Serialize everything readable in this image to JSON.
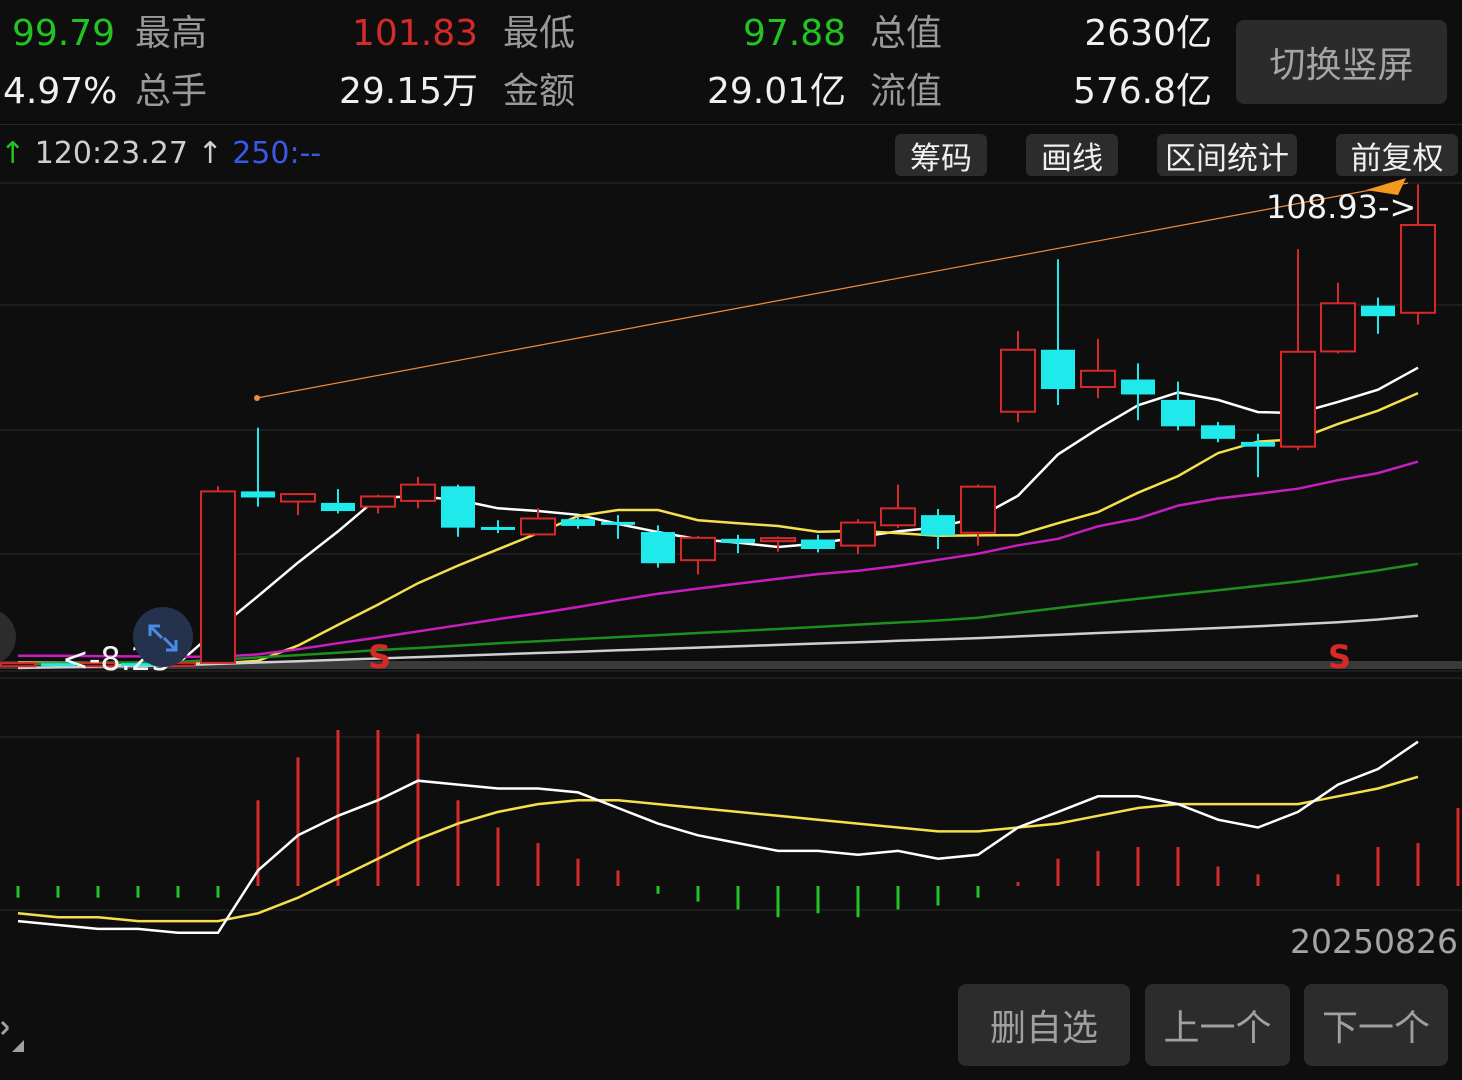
{
  "stats": {
    "price": "99.79",
    "high_label": "最高",
    "high": "101.83",
    "low_label": "最低",
    "low": "97.88",
    "total_mv_label": "总值",
    "total_mv": "2630亿",
    "change_pct": "4.97%",
    "volume_label": "总手",
    "volume": "29.15万",
    "amount_label": "金额",
    "amount": "29.01亿",
    "float_mv_label": "流值",
    "float_mv": "576.8亿"
  },
  "buttons": {
    "switch_portrait": "切换竖屏",
    "chip": "筹码",
    "draw_line": "画线",
    "range_stats": "区间统计",
    "forward_adjust": "前复权",
    "remove_watchlist": "删自选",
    "previous": "上一个",
    "next": "下一个"
  },
  "ma_legend": {
    "ma120": "120:23.27",
    "ma250": "250:--",
    "arrow": "↑"
  },
  "annotations": {
    "high_marker": "108.93->",
    "low_marker": "<-8.25",
    "signal_s": "S"
  },
  "date": "20250826",
  "colors": {
    "up": "#d62a2a",
    "down": "#1fe9ea",
    "ma5": "#ffffff",
    "ma10": "#f4e04d",
    "ma20": "#c81ec0",
    "ma60": "#1c8f1c",
    "ma120": "#cfcfcf",
    "trendline": "#f08b3a"
  },
  "chart_data": {
    "type": "candlestick",
    "candles": [
      {
        "o": 8.1,
        "c": 8.3,
        "h": 8.6,
        "l": 7.9
      },
      {
        "o": 8.3,
        "c": 8.0,
        "h": 8.4,
        "l": 7.9
      },
      {
        "o": 8.0,
        "c": 8.3,
        "h": 8.4,
        "l": 7.9
      },
      {
        "o": 8.3,
        "c": 8.1,
        "h": 8.4,
        "l": 8.0
      },
      {
        "o": 8.1,
        "c": 8.4,
        "h": 8.5,
        "l": 8.0
      },
      {
        "o": 8.4,
        "c": 59.0,
        "h": 60.5,
        "l": 8.4
      },
      {
        "o": 59.0,
        "c": 57.2,
        "h": 77.8,
        "l": 54.5
      },
      {
        "o": 56.0,
        "c": 58.2,
        "h": 58.5,
        "l": 52.0
      },
      {
        "o": 55.6,
        "c": 53.2,
        "h": 59.7,
        "l": 52.5
      },
      {
        "o": 54.5,
        "c": 57.5,
        "h": 58.0,
        "l": 52.5
      },
      {
        "o": 56.2,
        "c": 61.0,
        "h": 63.3,
        "l": 54.0
      },
      {
        "o": 60.5,
        "c": 48.3,
        "h": 61.0,
        "l": 45.6
      },
      {
        "o": 48.5,
        "c": 48.0,
        "h": 50.5,
        "l": 46.7
      },
      {
        "o": 46.3,
        "c": 51.0,
        "h": 54.0,
        "l": 46.3
      },
      {
        "o": 50.8,
        "c": 48.8,
        "h": 51.5,
        "l": 48.0
      },
      {
        "o": 50.0,
        "c": 49.2,
        "h": 52.0,
        "l": 45.0
      },
      {
        "o": 47.0,
        "c": 37.8,
        "h": 49.0,
        "l": 36.5
      },
      {
        "o": 38.7,
        "c": 45.3,
        "h": 45.8,
        "l": 34.5
      },
      {
        "o": 45.0,
        "c": 43.8,
        "h": 46.2,
        "l": 40.8
      },
      {
        "o": 44.5,
        "c": 45.2,
        "h": 45.7,
        "l": 41.2
      },
      {
        "o": 44.8,
        "c": 42.0,
        "h": 46.2,
        "l": 41.0
      },
      {
        "o": 43.0,
        "c": 49.8,
        "h": 50.8,
        "l": 40.5
      },
      {
        "o": 49.0,
        "c": 54.0,
        "h": 61.0,
        "l": 48.2
      },
      {
        "o": 52.0,
        "c": 46.0,
        "h": 53.8,
        "l": 42.0
      },
      {
        "o": 46.8,
        "c": 60.4,
        "h": 61.0,
        "l": 43.0
      },
      {
        "o": 82.5,
        "c": 100.8,
        "h": 106.3,
        "l": 79.4
      },
      {
        "o": 100.8,
        "c": 89.2,
        "h": 127.5,
        "l": 84.5
      },
      {
        "o": 89.8,
        "c": 94.6,
        "h": 104.0,
        "l": 86.5
      },
      {
        "o": 92.0,
        "c": 87.6,
        "h": 96.8,
        "l": 80.0
      },
      {
        "o": 86.0,
        "c": 78.2,
        "h": 91.4,
        "l": 77.0
      },
      {
        "o": 78.5,
        "c": 74.5,
        "h": 79.5,
        "l": 73.5
      },
      {
        "o": 73.6,
        "c": 72.2,
        "h": 76.0,
        "l": 63.2
      },
      {
        "o": 72.2,
        "c": 100.2,
        "h": 130.5,
        "l": 71.2
      },
      {
        "o": 100.3,
        "c": 114.5,
        "h": 120.6,
        "l": 99.7
      },
      {
        "o": 113.8,
        "c": 110.7,
        "h": 116.2,
        "l": 105.5
      },
      {
        "o": 111.7,
        "c": 137.6,
        "h": 149.6,
        "l": 108.2
      }
    ],
    "moving_averages": [
      {
        "name": "MA5",
        "color": "#ffffff",
        "values": [
          8.3,
          8.2,
          8.1,
          8.2,
          8.2,
          18.4,
          28.1,
          38.0,
          47.2,
          57.2,
          57.5,
          56.5,
          54.0,
          53.2,
          52.1,
          49.4,
          47.0,
          44.9,
          43.9,
          42.6,
          43.6,
          45.5,
          47.2,
          48.4,
          51.3,
          57.7,
          69.9,
          77.5,
          84.4,
          88.2,
          86.0,
          82.4,
          82.1,
          85.4,
          89.0,
          95.5
        ]
      },
      {
        "name": "MA10",
        "color": "#f4e04d",
        "values": [
          8.5,
          8.4,
          8.3,
          8.2,
          8.2,
          8.2,
          9.0,
          13.5,
          19.6,
          25.6,
          31.9,
          37.1,
          41.9,
          46.7,
          51.7,
          53.5,
          53.5,
          50.5,
          49.6,
          48.8,
          47.1,
          47.3,
          46.7,
          45.9,
          46.0,
          46.1,
          49.6,
          52.9,
          58.6,
          63.5,
          70.3,
          73.7,
          74.4,
          78.9,
          82.8,
          88.0
        ]
      },
      {
        "name": "MA20",
        "color": "#c81ec0",
        "values": [
          10.5,
          10.5,
          10.4,
          10.3,
          10.2,
          10.2,
          10.9,
          12.4,
          14.2,
          15.9,
          17.7,
          19.5,
          21.3,
          23.0,
          24.9,
          26.9,
          28.8,
          30.3,
          31.8,
          33.2,
          34.6,
          35.6,
          37.0,
          38.8,
          40.6,
          43.1,
          45.0,
          48.7,
          51.0,
          54.8,
          56.9,
          58.3,
          59.8,
          62.3,
          64.4,
          67.8
        ]
      },
      {
        "name": "MA60",
        "color": "#1c8f1c",
        "values": [
          8.2,
          8.2,
          8.3,
          8.5,
          8.7,
          9.3,
          10.0,
          10.7,
          11.4,
          12.2,
          12.8,
          13.5,
          14.2,
          14.8,
          15.4,
          16.0,
          16.6,
          17.2,
          17.8,
          18.4,
          19.0,
          19.7,
          20.3,
          20.9,
          21.7,
          23.2,
          24.6,
          26.0,
          27.3,
          28.6,
          29.8,
          31.1,
          32.4,
          34.0,
          35.7,
          37.6
        ]
      },
      {
        "name": "MA120",
        "color": "#cfcfcf",
        "values": [
          6.9,
          7.1,
          7.3,
          7.5,
          7.7,
          8.1,
          8.5,
          8.9,
          9.3,
          9.7,
          10.1,
          10.5,
          10.9,
          11.3,
          11.7,
          12.1,
          12.5,
          12.9,
          13.3,
          13.7,
          14.1,
          14.5,
          14.9,
          15.3,
          15.7,
          16.2,
          16.7,
          17.2,
          17.7,
          18.2,
          18.7,
          19.2,
          19.8,
          20.4,
          21.2,
          22.3
        ]
      }
    ],
    "macd": {
      "dif": [
        -9,
        -10,
        -11,
        -11,
        -12,
        -12,
        4,
        13,
        18,
        22,
        27,
        26,
        25,
        25,
        24,
        20,
        16,
        13,
        11,
        9,
        9,
        8,
        9,
        7,
        8,
        15,
        19,
        23,
        23,
        21,
        17,
        15,
        19,
        26,
        30,
        37
      ],
      "dea": [
        -7,
        -8,
        -8,
        -9,
        -9,
        -9,
        -7,
        -3,
        2,
        7,
        12,
        16,
        19,
        21,
        22,
        22,
        21,
        20,
        19,
        18,
        17,
        16,
        15,
        14,
        14,
        15,
        16,
        18,
        20,
        21,
        21,
        21,
        21,
        23,
        25,
        28
      ],
      "macd": [
        -3,
        -3,
        -3,
        -3,
        -3,
        -3,
        22,
        33,
        40,
        40,
        39,
        22,
        15,
        11,
        7,
        4,
        -2,
        -4,
        -6,
        -8,
        -7,
        -8,
        -6,
        -5,
        -3,
        1,
        7,
        9,
        10,
        10,
        5,
        3,
        0,
        3,
        10,
        11,
        20
      ]
    }
  }
}
